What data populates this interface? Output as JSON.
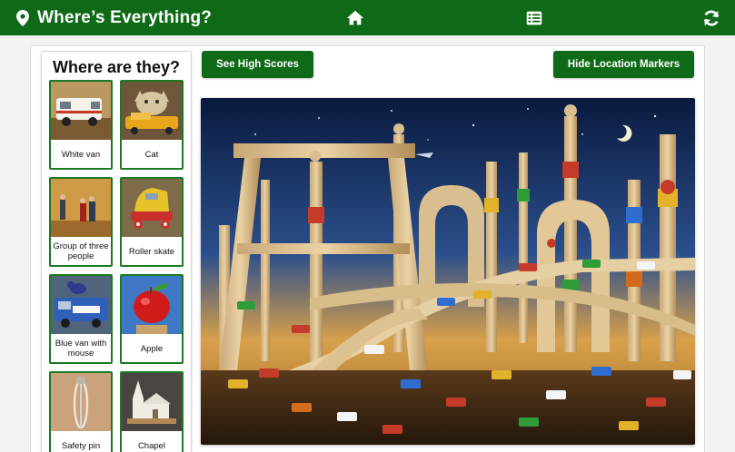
{
  "app": {
    "title": "Where’s Everything?",
    "logo_icon": "map-pin-icon",
    "home_icon": "home-icon",
    "list_icon": "list-icon",
    "refresh_icon": "refresh-icon",
    "header_color": "#0f6a17"
  },
  "sidebar": {
    "title": "Where are they?",
    "items": [
      {
        "label": "White van"
      },
      {
        "label": "Cat"
      },
      {
        "label": "Group of three people"
      },
      {
        "label": "Roller skate"
      },
      {
        "label": "Blue van with mouse"
      },
      {
        "label": "Apple"
      },
      {
        "label": "Safety pin"
      },
      {
        "label": "Chapel"
      }
    ]
  },
  "buttons": {
    "high_scores": "See High Scores",
    "toggle_markers": "Hide Location Markers"
  }
}
